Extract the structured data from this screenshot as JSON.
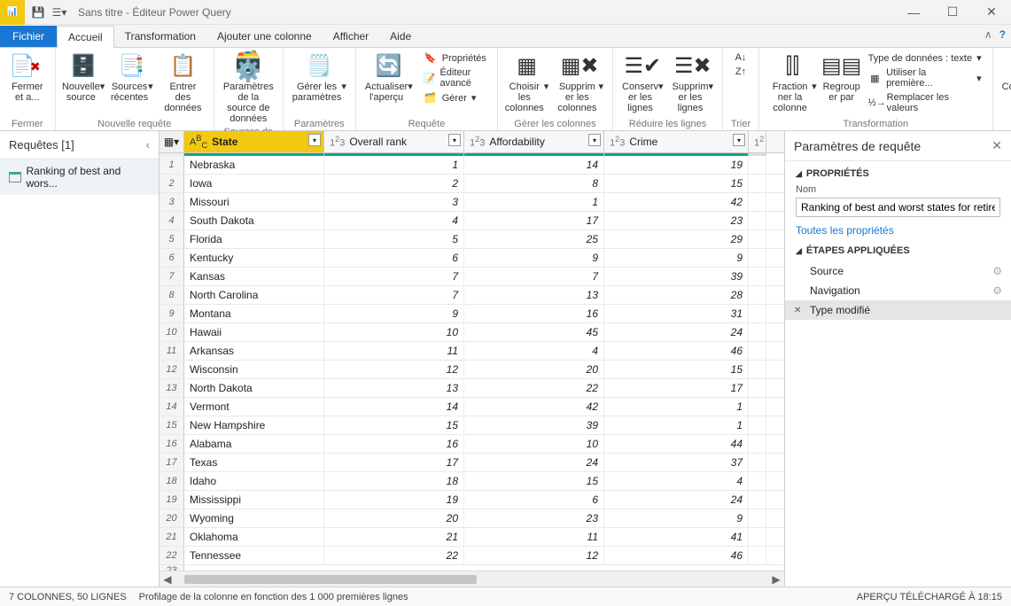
{
  "title": "Sans titre - Éditeur Power Query",
  "tabs": {
    "file": "Fichier",
    "home": "Accueil",
    "transform": "Transformation",
    "addcol": "Ajouter une colonne",
    "view": "Afficher",
    "help": "Aide"
  },
  "ribbon": {
    "close": {
      "apply": "Fermer et a...",
      "group": "Fermer"
    },
    "new_query": {
      "new_source": "Nouvelle source",
      "recent": "Sources récentes",
      "enter": "Entrer des données",
      "group": "Nouvelle requête"
    },
    "data_sources": {
      "settings": "Paramètres de la source de données",
      "group": "Sources de données"
    },
    "params": {
      "manage": "Gérer les paramètres",
      "group": "Paramètres"
    },
    "query": {
      "refresh": "Actualiser l'aperçu",
      "properties": "Propriétés",
      "advanced": "Éditeur avancé",
      "manage": "Gérer",
      "group": "Requête"
    },
    "manage_cols": {
      "choose": "Choisir les colonnes",
      "remove": "Supprim er les colonnes",
      "group": "Gérer les colonnes"
    },
    "reduce_rows": {
      "keep": "Conserv er les lignes",
      "remove": "Supprim er les lignes",
      "group": "Réduire les lignes"
    },
    "sort": {
      "group": "Trier"
    },
    "transform": {
      "split": "Fraction ner la colonne",
      "group_by": "Regroup er par",
      "data_type": "Type de données : texte",
      "first_row": "Utiliser la première...",
      "replace": "Remplacer les valeurs",
      "group": "Transformation"
    },
    "combine": {
      "combine": "Combiner"
    }
  },
  "queries_pane": {
    "title": "Requêtes [1]",
    "item": "Ranking of best and wors..."
  },
  "columns": {
    "state": "State",
    "overall": "Overall rank",
    "afford": "Affordability",
    "crime": "Crime"
  },
  "rows": [
    {
      "n": 1,
      "state": "Nebraska",
      "rank": 1,
      "afford": 14,
      "crime": 19
    },
    {
      "n": 2,
      "state": "Iowa",
      "rank": 2,
      "afford": 8,
      "crime": 15
    },
    {
      "n": 3,
      "state": "Missouri",
      "rank": 3,
      "afford": 1,
      "crime": 42
    },
    {
      "n": 4,
      "state": "South Dakota",
      "rank": 4,
      "afford": 17,
      "crime": 23
    },
    {
      "n": 5,
      "state": "Florida",
      "rank": 5,
      "afford": 25,
      "crime": 29
    },
    {
      "n": 6,
      "state": "Kentucky",
      "rank": 6,
      "afford": 9,
      "crime": 9
    },
    {
      "n": 7,
      "state": "Kansas",
      "rank": 7,
      "afford": 7,
      "crime": 39
    },
    {
      "n": 8,
      "state": "North Carolina",
      "rank": 7,
      "afford": 13,
      "crime": 28
    },
    {
      "n": 9,
      "state": "Montana",
      "rank": 9,
      "afford": 16,
      "crime": 31
    },
    {
      "n": 10,
      "state": "Hawaii",
      "rank": 10,
      "afford": 45,
      "crime": 24
    },
    {
      "n": 11,
      "state": "Arkansas",
      "rank": 11,
      "afford": 4,
      "crime": 46
    },
    {
      "n": 12,
      "state": "Wisconsin",
      "rank": 12,
      "afford": 20,
      "crime": 15
    },
    {
      "n": 13,
      "state": "North Dakota",
      "rank": 13,
      "afford": 22,
      "crime": 17
    },
    {
      "n": 14,
      "state": "Vermont",
      "rank": 14,
      "afford": 42,
      "crime": 1
    },
    {
      "n": 15,
      "state": "New Hampshire",
      "rank": 15,
      "afford": 39,
      "crime": 1
    },
    {
      "n": 16,
      "state": "Alabama",
      "rank": 16,
      "afford": 10,
      "crime": 44
    },
    {
      "n": 17,
      "state": "Texas",
      "rank": 17,
      "afford": 24,
      "crime": 37
    },
    {
      "n": 18,
      "state": "Idaho",
      "rank": 18,
      "afford": 15,
      "crime": 4
    },
    {
      "n": 19,
      "state": "Mississippi",
      "rank": 19,
      "afford": 6,
      "crime": 24
    },
    {
      "n": 20,
      "state": "Wyoming",
      "rank": 20,
      "afford": 23,
      "crime": 9
    },
    {
      "n": 21,
      "state": "Oklahoma",
      "rank": 21,
      "afford": 11,
      "crime": 41
    },
    {
      "n": 22,
      "state": "Tennessee",
      "rank": 22,
      "afford": 12,
      "crime": 46
    }
  ],
  "settings": {
    "title": "Paramètres de requête",
    "properties": "PROPRIÉTÉS",
    "name_label": "Nom",
    "name_value": "Ranking of best and worst states for retire",
    "all_props": "Toutes les propriétés",
    "applied": "ÉTAPES APPLIQUÉES",
    "steps": {
      "source": "Source",
      "nav": "Navigation",
      "type": "Type modifié"
    }
  },
  "status": {
    "cols": "7 COLONNES, 50 LIGNES",
    "profiling": "Profilage de la colonne en fonction des 1 000 premières lignes",
    "preview": "APERÇU TÉLÉCHARGÉ À 18:15"
  }
}
